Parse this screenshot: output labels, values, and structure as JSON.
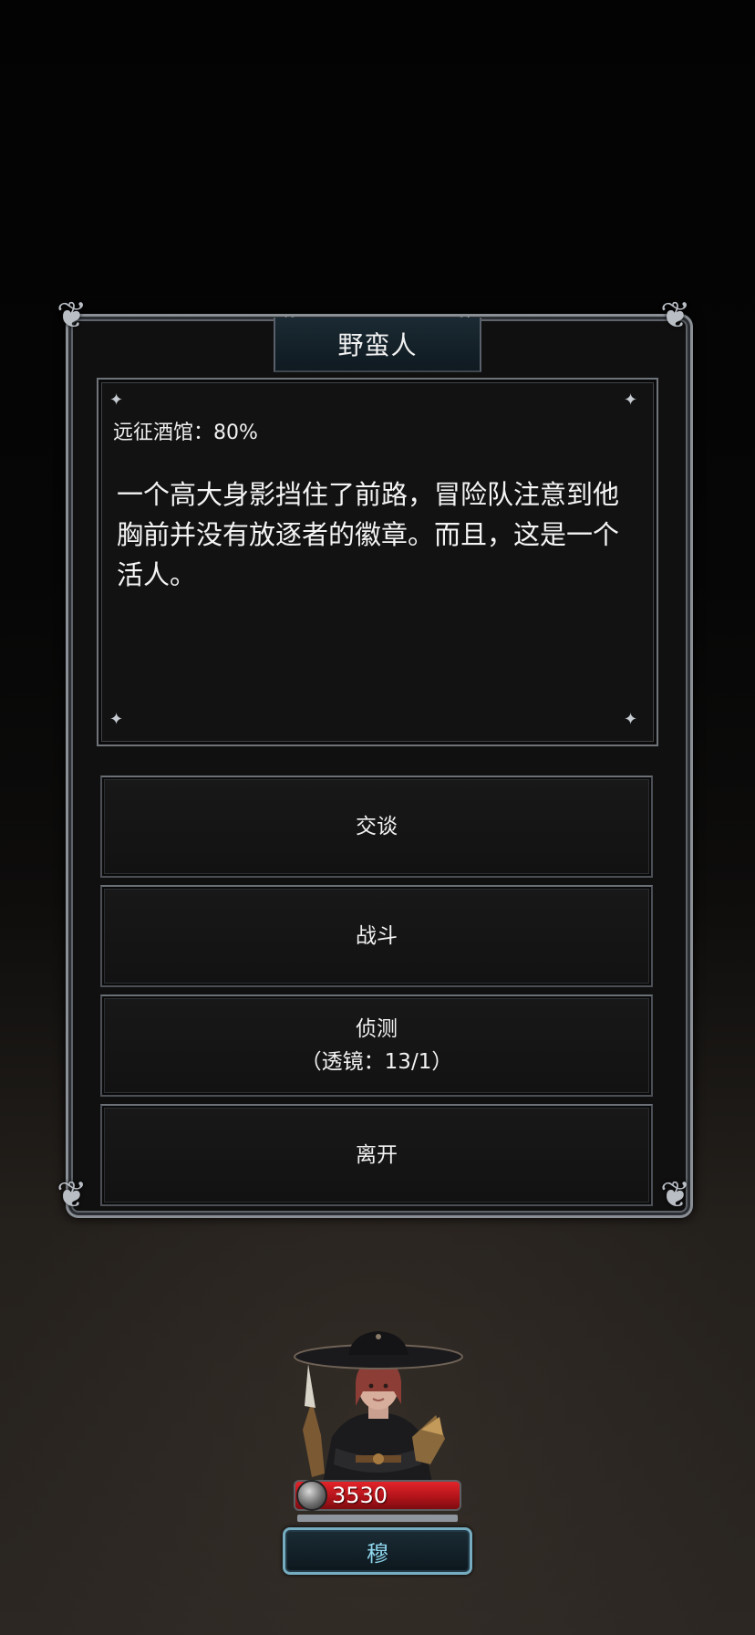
{
  "event": {
    "title": "野蛮人",
    "source": "远征酒馆：80%",
    "description": "一个高大身影挡住了前路，冒险队注意到他胸前并没有放逐者的徽章。而且，这是一个活人。"
  },
  "options": [
    {
      "label": "交谈"
    },
    {
      "label": "战斗"
    },
    {
      "label": "侦测",
      "sub": "（透镜：13/1）"
    },
    {
      "label": "离开"
    }
  ],
  "character": {
    "hp": "3530",
    "name": "穆"
  },
  "colors": {
    "hp_bar": "#c81a20",
    "name_plate_border": "#76acc0",
    "name_text": "#8fd7ee",
    "frame_border": "#8a8f96"
  }
}
